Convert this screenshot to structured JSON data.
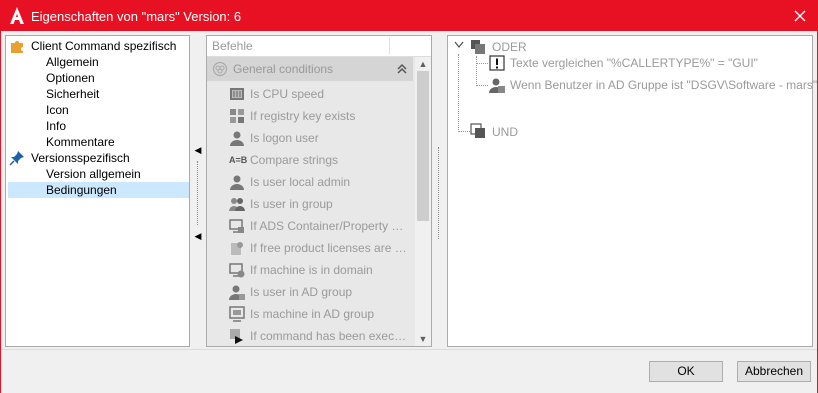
{
  "window": {
    "title": "Eigenschaften von \"mars\" Version: 6",
    "accent_color": "#e81123",
    "logo_icon": "autodesk-a-icon",
    "close_icon": "close-icon"
  },
  "left_tree": {
    "items": [
      {
        "label": "Client Command spezifisch",
        "level": 0,
        "icon": "puzzle-icon",
        "selected": false
      },
      {
        "label": "Allgemein",
        "level": 1,
        "selected": false
      },
      {
        "label": "Optionen",
        "level": 1,
        "selected": false
      },
      {
        "label": "Sicherheit",
        "level": 1,
        "selected": false
      },
      {
        "label": "Icon",
        "level": 1,
        "selected": false
      },
      {
        "label": "Info",
        "level": 1,
        "selected": false
      },
      {
        "label": "Kommentare",
        "level": 1,
        "selected": false
      },
      {
        "label": "Versionsspezifisch",
        "level": 0,
        "icon": "pin-icon",
        "selected": false
      },
      {
        "label": "Version allgemein",
        "level": 1,
        "selected": false
      },
      {
        "label": "Bedingungen",
        "level": 1,
        "selected": true
      }
    ]
  },
  "middle": {
    "search_placeholder": "Befehle",
    "group_label": "General conditions",
    "items": [
      {
        "label": "Is CPU speed",
        "icon": "cpu-chip-icon"
      },
      {
        "label": "If registry key exists",
        "icon": "registry-icon"
      },
      {
        "label": "Is logon user",
        "icon": "user-icon"
      },
      {
        "label": "Compare strings",
        "icon": "compare-strings-icon"
      },
      {
        "label": "Is user local admin",
        "icon": "user-admin-icon"
      },
      {
        "label": "Is user in group",
        "icon": "user-group-icon"
      },
      {
        "label": "If ADS Container/Property mat...",
        "icon": "ads-container-icon"
      },
      {
        "label": "If free product licenses are av...",
        "icon": "license-icon"
      },
      {
        "label": "If machine is in domain",
        "icon": "machine-domain-icon"
      },
      {
        "label": "Is user in AD group",
        "icon": "user-ad-group-icon"
      },
      {
        "label": "Is machine in AD group",
        "icon": "machine-ad-group-icon"
      },
      {
        "label": "If command has been executed",
        "icon": "command-executed-icon"
      }
    ]
  },
  "right_tree": {
    "or_label": "ODER",
    "cond1": "Texte vergleichen \"%CALLERTYPE%\" = \"GUI\"",
    "cond2": "Wenn Benutzer in AD Gruppe ist \"DSGV\\Software - mars\"",
    "and_label": "UND"
  },
  "footer": {
    "ok_label": "OK",
    "cancel_label": "Abbrechen"
  }
}
